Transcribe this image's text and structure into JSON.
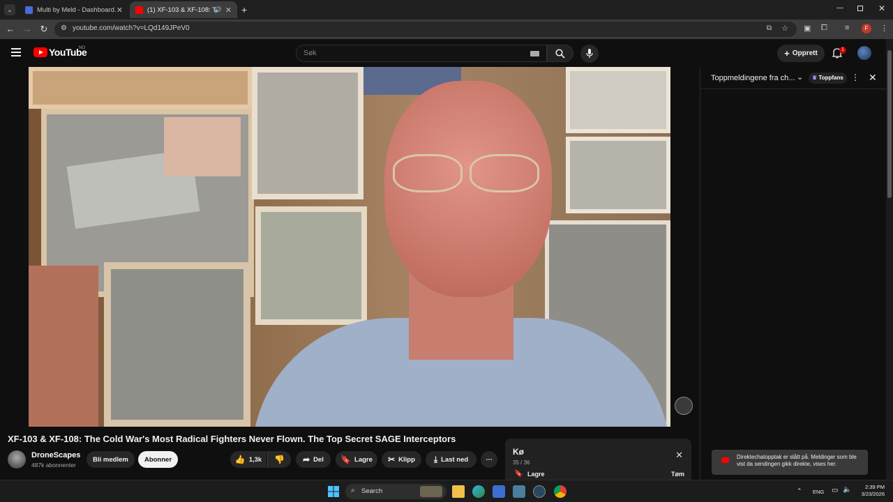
{
  "browser": {
    "tabs": [
      {
        "title": "Multi by Meld - Dashboard.",
        "active": false
      },
      {
        "title": "(1) XF-103 & XF-108: The C",
        "active": true
      }
    ],
    "url": "youtube.com/watch?v=LQd149JPeV0",
    "profile_initial": "F"
  },
  "youtube": {
    "logo_text": "YouTube",
    "region": "NO",
    "search_placeholder": "Søk",
    "create_label": "Opprett",
    "notification_count": "1"
  },
  "chat": {
    "title": "Toppmeldingene fra ch...",
    "badge": "Toppfans",
    "notice": "Direktechatopptak er slått på. Meldinger som ble vist da sendingen gikk direkte, vises her."
  },
  "video": {
    "title": "XF-103 & XF-108: The Cold War's Most Radical Fighters Never Flown. The Top Secret SAGE Interceptors",
    "channel": "DroneScapes",
    "subscribers": "487k abonnenter",
    "join_label": "Bli medlem",
    "subscribe_label": "Abonner",
    "likes": "1,3k",
    "share_label": "Del",
    "save_label": "Lagre",
    "clip_label": "Klipp",
    "download_label": "Last ned"
  },
  "queue": {
    "title": "Kø",
    "count": "35 / 36",
    "save_label": "Lagre",
    "clear_label": "Tøm"
  },
  "taskbar": {
    "search_label": "Search",
    "language": "ENG",
    "time": "2:39 PM",
    "date": "3/23/2026"
  },
  "colors": {
    "youtube_red": "#ff0000",
    "background": "#0f0f0f",
    "pill": "#272727"
  }
}
